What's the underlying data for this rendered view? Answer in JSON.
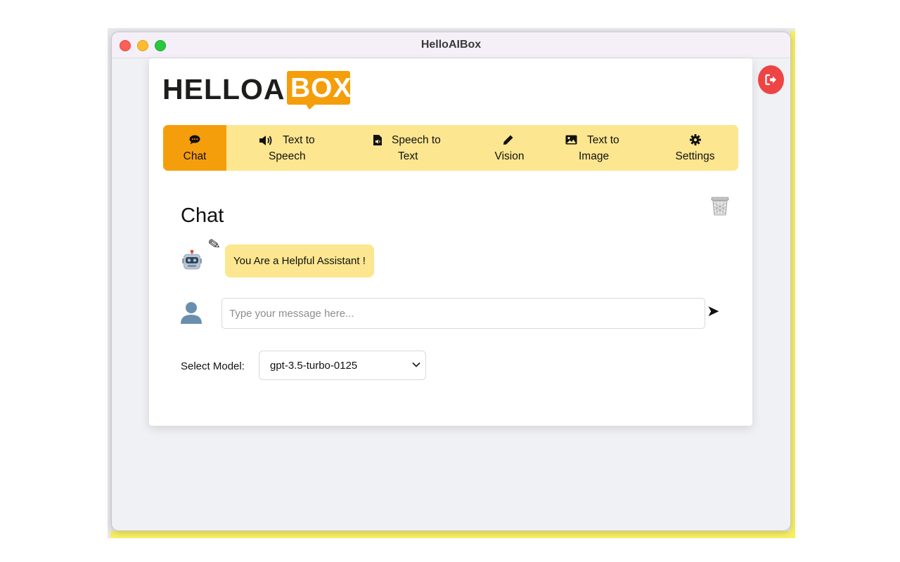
{
  "window": {
    "title": "HelloAIBox"
  },
  "logo": {
    "hello": "HELLOAI",
    "box": "BOX"
  },
  "tabs": [
    {
      "line1": "Chat",
      "line2": "",
      "icon": "comment-icon"
    },
    {
      "line1": "Text to",
      "line2": "Speech",
      "icon": "volume-icon"
    },
    {
      "line1": "Speech to",
      "line2": "Text",
      "icon": "audio-file-icon"
    },
    {
      "line1": "Vision",
      "line2": "",
      "icon": "pencil-icon"
    },
    {
      "line1": "Text to",
      "line2": "Image",
      "icon": "image-icon"
    },
    {
      "line1": "Settings",
      "line2": "",
      "icon": "gear-icon"
    }
  ],
  "chat": {
    "heading": "Chat",
    "system_message": "You Are a Helpful Assistant !",
    "edit_glyph": "✎",
    "send_glyph": "➤",
    "input_placeholder": "Type your message here..."
  },
  "model": {
    "label": "Select Model:",
    "value": "gpt-3.5-turbo-0125"
  },
  "colors": {
    "accent": "#f59e0b",
    "tab_bg": "#fce68f",
    "logout": "#ef4444"
  }
}
